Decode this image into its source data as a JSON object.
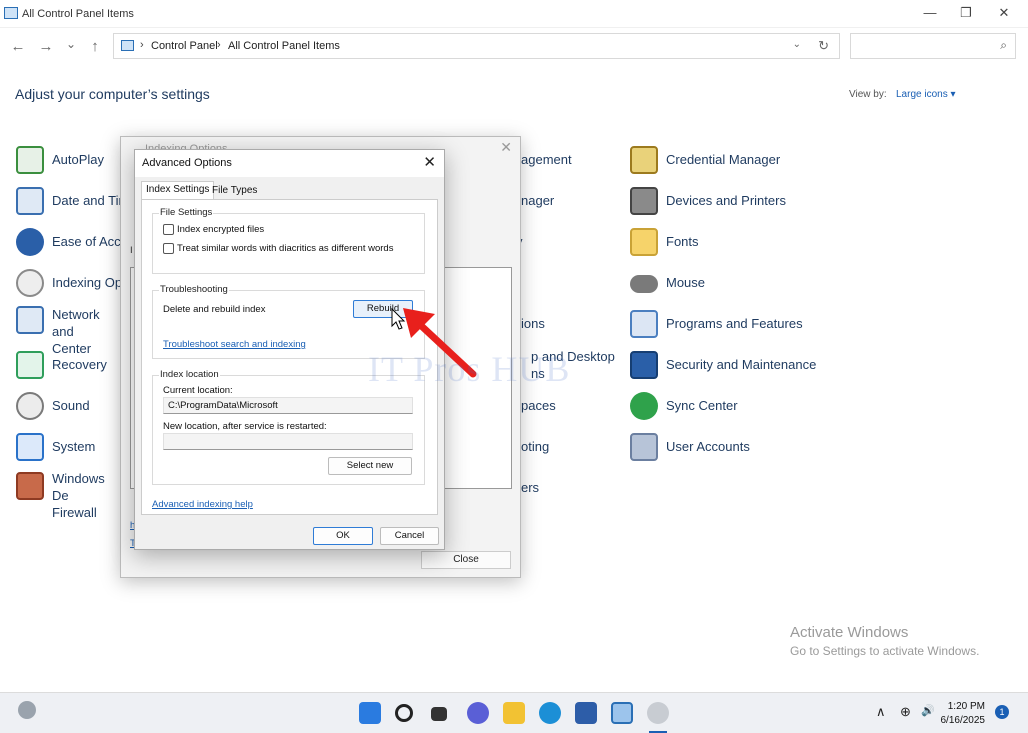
{
  "window": {
    "title": "All Control Panel Items",
    "minimize": "—",
    "maximize": "❐",
    "close": "✕"
  },
  "nav": {
    "back": "←",
    "forward": "→",
    "recent": "⌄",
    "up": "↑"
  },
  "address": {
    "crumb1": "Control Panel",
    "crumb2": "All Control Panel Items",
    "sep": "›",
    "dropdown": "⌄",
    "refresh": "↻"
  },
  "search": {
    "placeholder": "",
    "icon": "⌕"
  },
  "page": {
    "heading": "Adjust your computer’s settings",
    "view_by_label": "View by:",
    "view_by_value": "Large icons ▾"
  },
  "items_left": [
    {
      "label": "AutoPlay",
      "icon": "autoplay-icon",
      "color": "#3b8f3e"
    },
    {
      "label": "Date and Tin",
      "icon": "date-time-icon",
      "color": "#3a6fb0"
    },
    {
      "label": "Ease of Acce",
      "icon": "ease-of-access-icon",
      "color": "#2a5fa8"
    },
    {
      "label": "Indexing Op",
      "icon": "indexing-icon",
      "color": "#8a8a8a"
    },
    {
      "label": "Network and\nCenter",
      "icon": "network-icon",
      "color": "#3a6fb0"
    },
    {
      "label": "Recovery",
      "icon": "recovery-icon",
      "color": "#2f9e5b"
    },
    {
      "label": "Sound",
      "icon": "sound-icon",
      "color": "#7a7a7a"
    },
    {
      "label": "System",
      "icon": "system-icon",
      "color": "#2a72c9"
    },
    {
      "label": "Windows De\nFirewall",
      "icon": "firewall-icon",
      "color": "#b5502f"
    }
  ],
  "items_mid": [
    "agement",
    "nager",
    "y",
    "",
    "ions",
    "p and Desktop\nns",
    "paces",
    "oting",
    "ers"
  ],
  "items_right": [
    {
      "label": "Credential Manager",
      "icon": "credential-manager-icon",
      "color": "#c9a236"
    },
    {
      "label": "Devices and Printers",
      "icon": "devices-printers-icon",
      "color": "#555555"
    },
    {
      "label": "Fonts",
      "icon": "fonts-icon",
      "color": "#e8b731"
    },
    {
      "label": "Mouse",
      "icon": "mouse-icon",
      "color": "#666666"
    },
    {
      "label": "Programs and Features",
      "icon": "programs-features-icon",
      "color": "#4b7fc0"
    },
    {
      "label": "Security and Maintenance",
      "icon": "security-maintenance-icon",
      "color": "#2a5fa8"
    },
    {
      "label": "Sync Center",
      "icon": "sync-center-icon",
      "color": "#2fa24b"
    },
    {
      "label": "User Accounts",
      "icon": "user-accounts-icon",
      "color": "#6b7fa0"
    }
  ],
  "indexing_dialog": {
    "title": "Indexing Options",
    "close": "✕",
    "close_button": "Close",
    "left_fragment_1": "I",
    "left_fragment_2": "h",
    "left_fragment_3": "T"
  },
  "advanced_dialog": {
    "title": "Advanced Options",
    "close": "✕",
    "tabs": [
      "Index Settings",
      "File Types"
    ],
    "file_settings": {
      "title": "File Settings",
      "opt1": "Index encrypted files",
      "opt2": "Treat similar words with diacritics as different words"
    },
    "troubleshooting": {
      "title": "Troubleshooting",
      "text": "Delete and rebuild index",
      "rebuild": "Rebuild",
      "link": "Troubleshoot search and indexing"
    },
    "index_location": {
      "title": "Index location",
      "current_label": "Current location:",
      "current_value": "C:\\ProgramData\\Microsoft",
      "new_label": "New location, after service is restarted:",
      "new_value": "",
      "select_new": "Select new"
    },
    "help_link": "Advanced indexing help",
    "ok": "OK",
    "cancel": "Cancel"
  },
  "watermark": {
    "text": "IT Pros HUB"
  },
  "activation": {
    "line1": "Activate Windows",
    "line2": "Go to Settings to activate Windows."
  },
  "taskbar": {
    "time": "1:20 PM",
    "date": "6/16/2025",
    "badge": "1",
    "chevron": "∧",
    "globe": "⊕",
    "speaker": "🔊"
  },
  "annotation": {
    "arrow_color": "#e8201c"
  }
}
